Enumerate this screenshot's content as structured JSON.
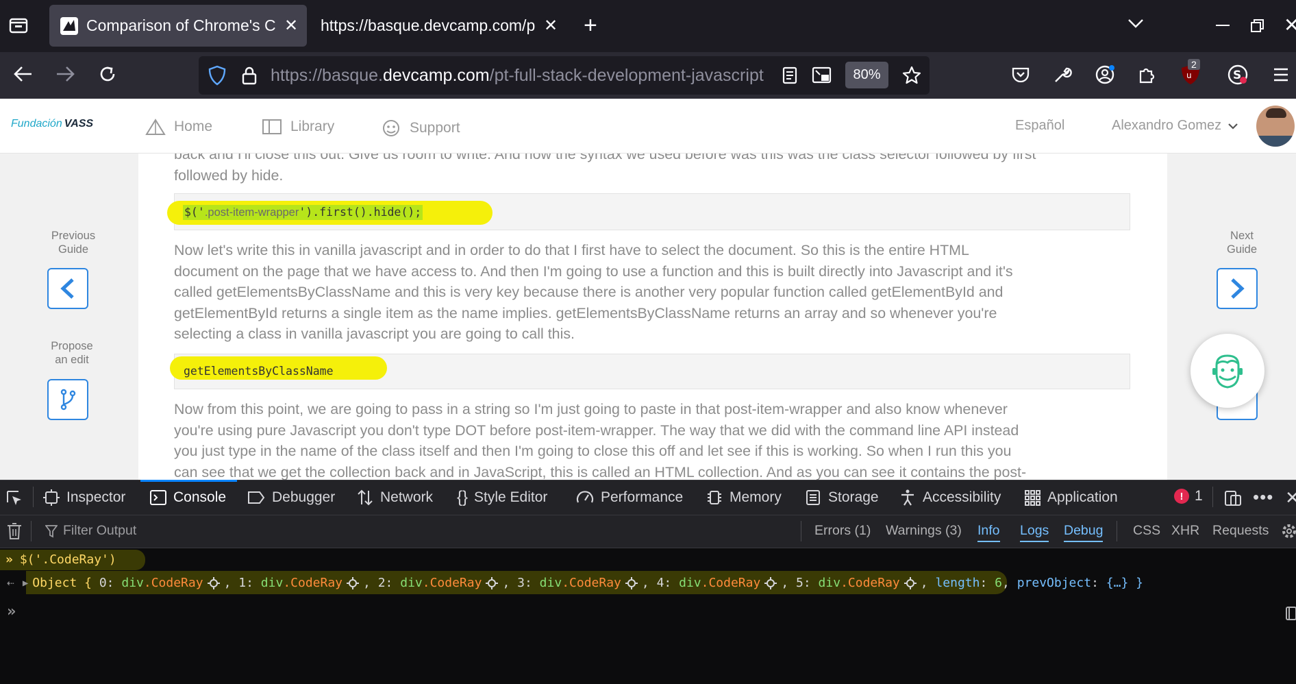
{
  "browser": {
    "tabs": [
      {
        "title": "Comparison of Chrome's C",
        "active": true
      },
      {
        "title": "https://basque.devcamp.com/p",
        "active": false
      }
    ],
    "url": {
      "prefix": "https://basque.",
      "domain": "devcamp.com",
      "path": "/pt-full-stack-development-javascript"
    },
    "zoom": "80%",
    "ublock_badge": "2"
  },
  "site": {
    "logo": {
      "part1": "Fundación",
      "part2": "VASS"
    },
    "nav": [
      {
        "label": "Home",
        "icon": "home-icon"
      },
      {
        "label": "Library",
        "icon": "book-icon"
      },
      {
        "label": "Support",
        "icon": "support-icon"
      }
    ],
    "language": "Español",
    "user": "Alexandro Gomez",
    "left_sidebar": {
      "previous_line1": "Previous",
      "previous_line2": "Guide",
      "propose_line1": "Propose",
      "propose_line2": "an edit"
    },
    "right_sidebar": {
      "next_line1": "Next",
      "next_line2": "Guide"
    },
    "content": {
      "para0_line1": "back and I'll close this out. Give us room to write. And now the syntax we used before was this was the class selector followed by first",
      "para0_line2": "followed by hide.",
      "code1": {
        "p1": "$('",
        "p2": ".post-item-wrapper",
        "p3": "').first().hide();"
      },
      "para1": [
        "Now let's write this in vanilla javascript and in order to do that I first have to select the document. So this is the entire HTML",
        "document on the page that we have access to. And then I'm going to use a function and this is built directly into Javascript and it's",
        "called getElementsByClassName and this is very key because there is another very popular function called getElementById and",
        "getElementById returns a single item as the name implies. getElementsByClassName returns an array and so whenever you're",
        "selecting a class in vanilla javascript you are going to call this."
      ],
      "code2": "getElementsByClassName",
      "para2": [
        "Now from this point, we are going to pass in a string so I'm just going to paste in that post-item-wrapper and also know whenever",
        "you're using pure Javascript you don't type DOT before post-item-wrapper. The way that we did with the command line API instead",
        "you just type in the name of the class itself and then I'm going to close this off and let see if this is working. So when I run this you",
        "can see that we get the collection back and in JavaScript, this is called an HTML collection. And as you can see it contains the post-"
      ]
    }
  },
  "devtools": {
    "tabs": [
      "Inspector",
      "Console",
      "Debugger",
      "Network",
      "Style Editor",
      "Performance",
      "Memory",
      "Storage",
      "Accessibility",
      "Application"
    ],
    "active_tab": "Console",
    "error_count": "1",
    "filter_placeholder": "Filter Output",
    "filters": {
      "errors": "Errors (1)",
      "warnings": "Warnings (3)",
      "info": "Info",
      "logs": "Logs",
      "debug": "Debug",
      "css": "CSS",
      "xhr": "XHR",
      "requests": "Requests"
    },
    "console": {
      "input": "$('.CodeRay')",
      "result_prefix": "Object { ",
      "entries": [
        {
          "key": "0",
          "tag": "div",
          "cls": ".CodeRay"
        },
        {
          "key": "1",
          "tag": "div",
          "cls": ".CodeRay"
        },
        {
          "key": "2",
          "tag": "div",
          "cls": ".CodeRay"
        },
        {
          "key": "3",
          "tag": "div",
          "cls": ".CodeRay"
        },
        {
          "key": "4",
          "tag": "div",
          "cls": ".CodeRay"
        },
        {
          "key": "5",
          "tag": "div",
          "cls": ".CodeRay"
        }
      ],
      "length_key": "length",
      "length_value": "6",
      "prevobject_key": "prevObject",
      "prevobject_value": "{…}",
      "result_suffix": "}"
    }
  }
}
